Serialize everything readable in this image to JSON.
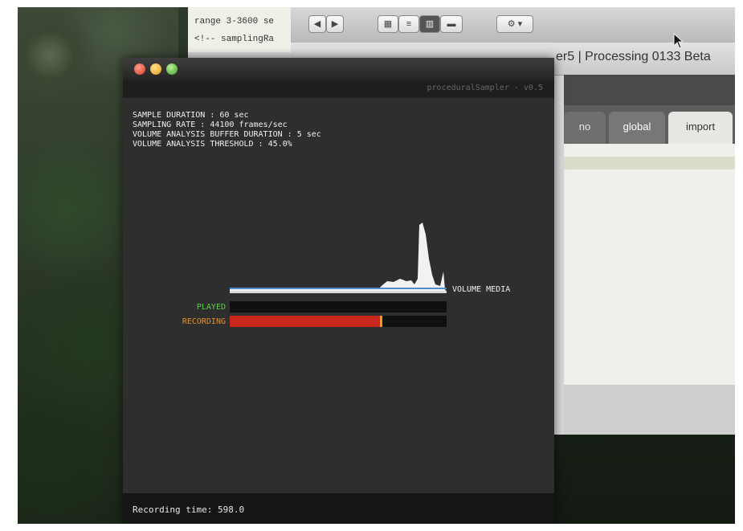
{
  "background_window": {
    "code_lines": [
      "range 3-3600 se",
      "<!-- samplingRa"
    ],
    "title": "er5 | Processing 0133 Beta",
    "tabs": [
      "no",
      "global",
      "import"
    ]
  },
  "sketch": {
    "title": "proceduralSampler - v0.5",
    "info_lines": [
      "SAMPLE DURATION : 60 sec",
      "SAMPLING RATE : 44100 frames/sec",
      "VOLUME ANALYSIS BUFFER DURATION : 5 sec",
      "VOLUME ANALYSIS THRESHOLD : 45.0%"
    ],
    "volume_label": "VOLUME MEDIA",
    "played_label": "PLAYED",
    "recording_label": "RECORDING",
    "played_progress": 0,
    "recording_progress": 0.7,
    "footer": "Recording time: 598.0",
    "colors": {
      "played": "#5fc94a",
      "recording": "#e8902a",
      "recording_bar": "#c8281c",
      "median_line": "#4c8fd0"
    }
  }
}
